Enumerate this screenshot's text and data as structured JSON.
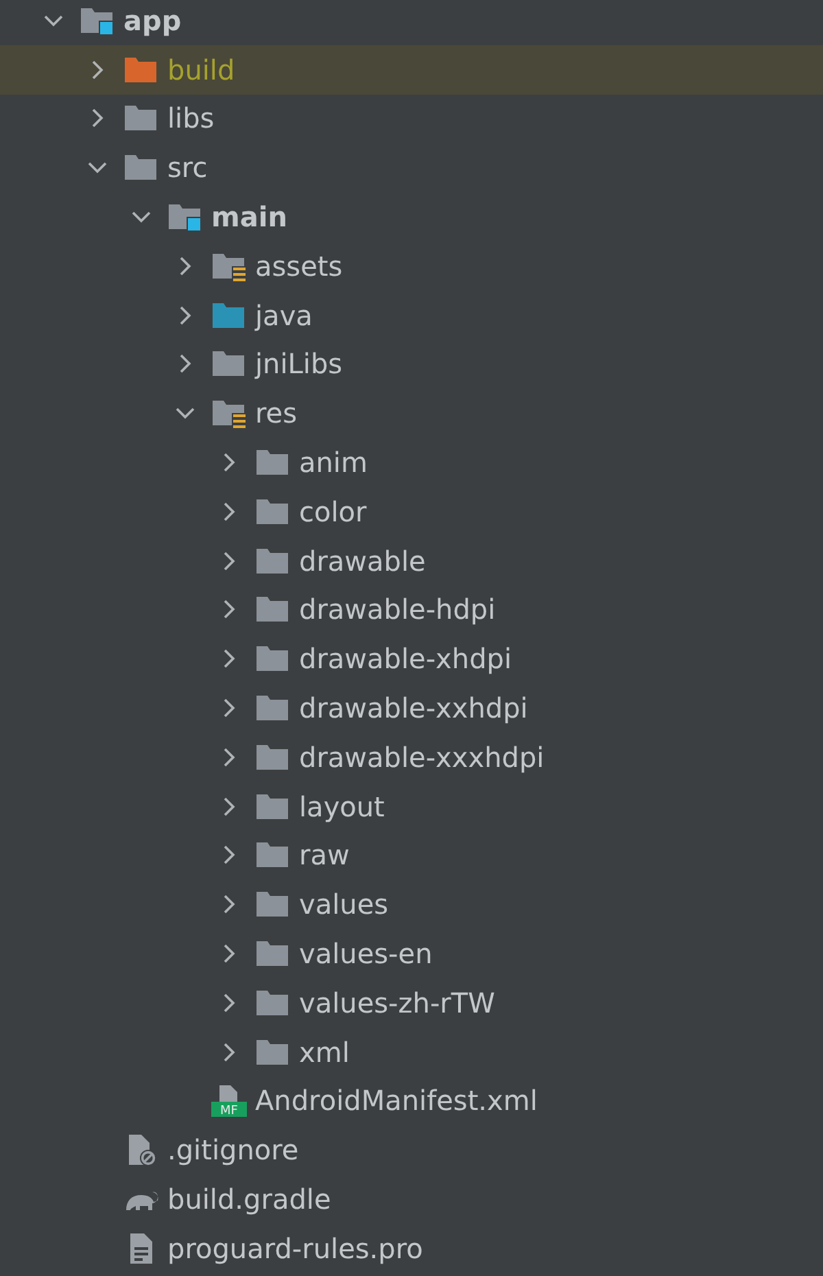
{
  "tree": [
    {
      "label": "app",
      "kind": "module",
      "expanded": true,
      "selected": false,
      "children": [
        {
          "label": "build",
          "kind": "excluded",
          "expanded": false,
          "selected": true
        },
        {
          "label": "libs",
          "kind": "folder",
          "expanded": false,
          "selected": false
        },
        {
          "label": "src",
          "kind": "folder",
          "expanded": true,
          "selected": false,
          "children": [
            {
              "label": "main",
              "kind": "module",
              "expanded": true,
              "selected": false,
              "children": [
                {
                  "label": "assets",
                  "kind": "resources",
                  "expanded": false,
                  "selected": false
                },
                {
                  "label": "java",
                  "kind": "source",
                  "expanded": false,
                  "selected": false
                },
                {
                  "label": "jniLibs",
                  "kind": "folder",
                  "expanded": false,
                  "selected": false
                },
                {
                  "label": "res",
                  "kind": "resources",
                  "expanded": true,
                  "selected": false,
                  "children": [
                    {
                      "label": "anim",
                      "kind": "folder",
                      "expanded": false,
                      "selected": false
                    },
                    {
                      "label": "color",
                      "kind": "folder",
                      "expanded": false,
                      "selected": false
                    },
                    {
                      "label": "drawable",
                      "kind": "folder",
                      "expanded": false,
                      "selected": false
                    },
                    {
                      "label": "drawable-hdpi",
                      "kind": "folder",
                      "expanded": false,
                      "selected": false
                    },
                    {
                      "label": "drawable-xhdpi",
                      "kind": "folder",
                      "expanded": false,
                      "selected": false
                    },
                    {
                      "label": "drawable-xxhdpi",
                      "kind": "folder",
                      "expanded": false,
                      "selected": false
                    },
                    {
                      "label": "drawable-xxxhdpi",
                      "kind": "folder",
                      "expanded": false,
                      "selected": false
                    },
                    {
                      "label": "layout",
                      "kind": "folder",
                      "expanded": false,
                      "selected": false
                    },
                    {
                      "label": "raw",
                      "kind": "folder",
                      "expanded": false,
                      "selected": false
                    },
                    {
                      "label": "values",
                      "kind": "folder",
                      "expanded": false,
                      "selected": false
                    },
                    {
                      "label": "values-en",
                      "kind": "folder",
                      "expanded": false,
                      "selected": false
                    },
                    {
                      "label": "values-zh-rTW",
                      "kind": "folder",
                      "expanded": false,
                      "selected": false
                    },
                    {
                      "label": "xml",
                      "kind": "folder",
                      "expanded": false,
                      "selected": false
                    }
                  ]
                },
                {
                  "label": "AndroidManifest.xml",
                  "kind": "manifest",
                  "icon_label": "MF",
                  "selected": false
                }
              ]
            }
          ]
        },
        {
          "label": ".gitignore",
          "kind": "ignore",
          "selected": false
        },
        {
          "label": "build.gradle",
          "kind": "gradle",
          "selected": false
        },
        {
          "label": "proguard-rules.pro",
          "kind": "text",
          "selected": false
        }
      ]
    }
  ]
}
